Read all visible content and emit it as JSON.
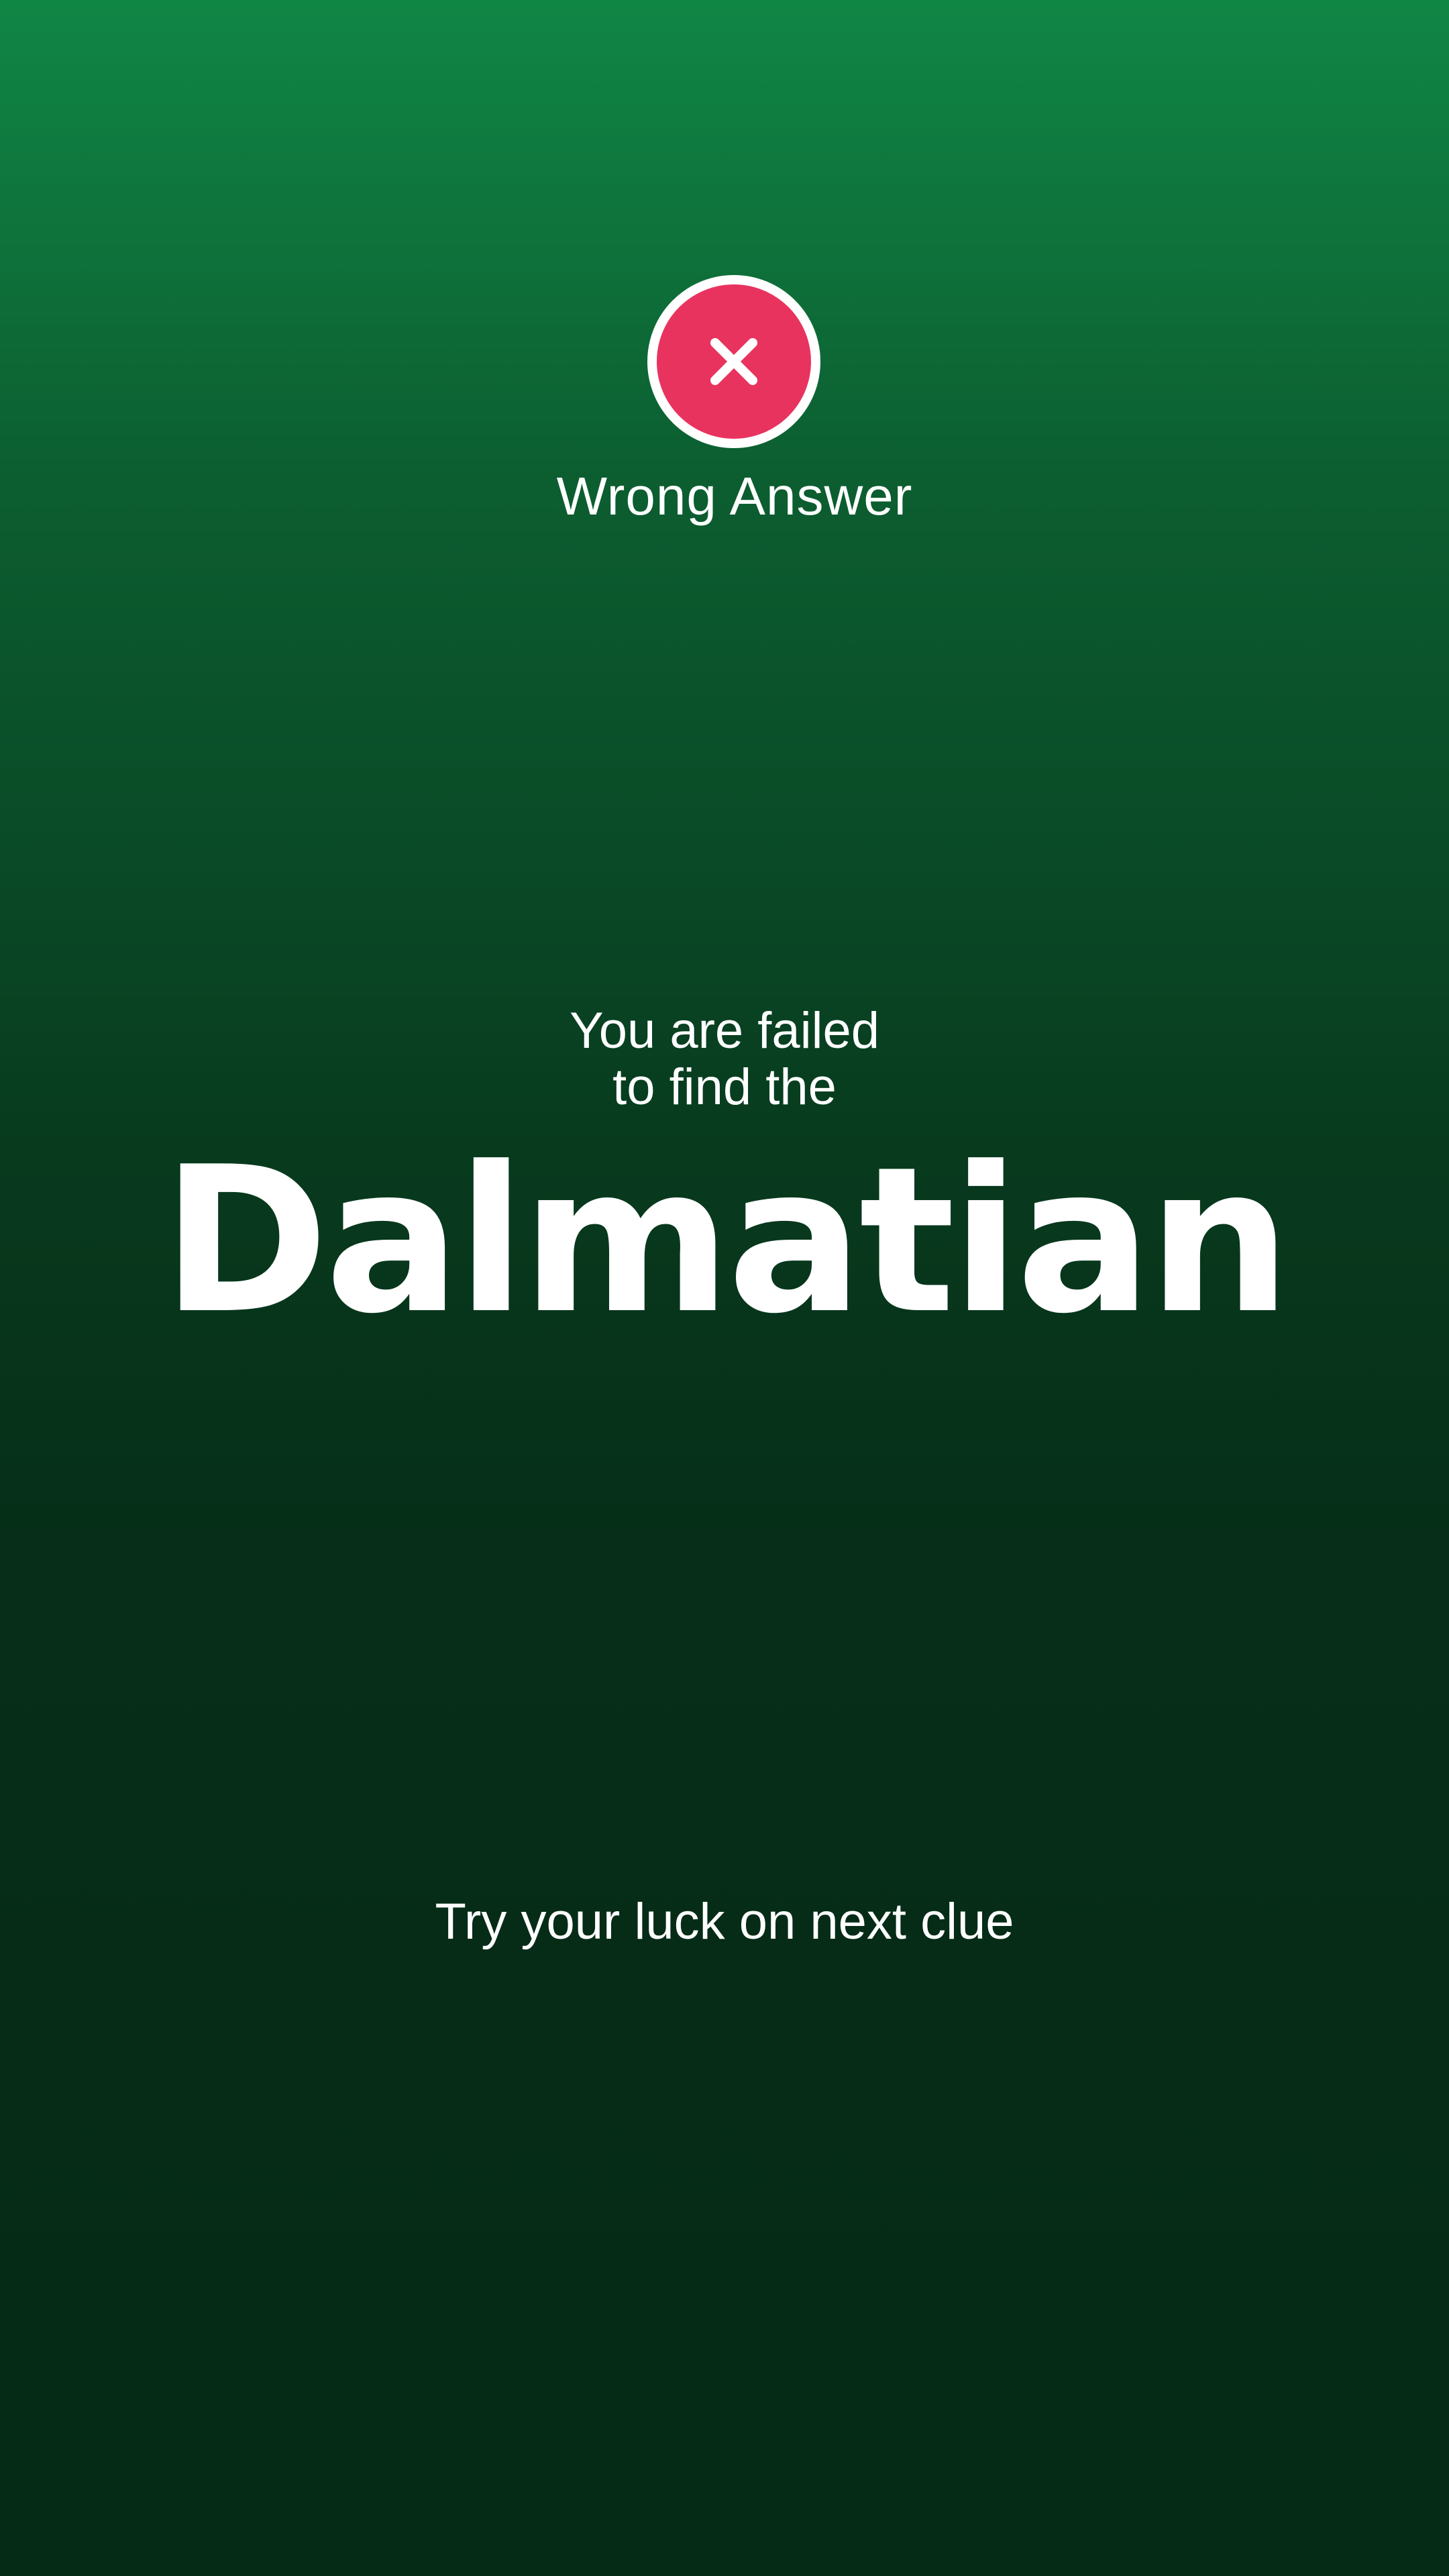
{
  "result": {
    "icon": "close-icon",
    "icon_color": "#e9335f",
    "label": "Wrong Answer"
  },
  "message": {
    "line1": "You are failed",
    "line2": "to find the"
  },
  "target": {
    "word": "Dalmatian"
  },
  "hint": {
    "text": "Try your luck on next clue"
  },
  "theme": {
    "background_top": "#108645",
    "background_bottom": "#052a16",
    "text_color": "#ffffff"
  }
}
